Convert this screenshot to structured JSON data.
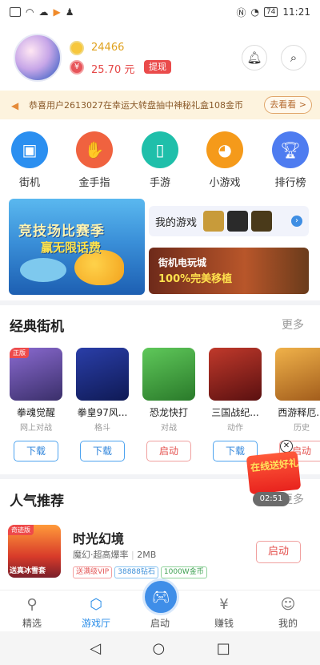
{
  "status_bar": {
    "time": "11:21",
    "battery": "74"
  },
  "profile": {
    "coins": "24466",
    "money": "25.70 元",
    "money_icon": "¥",
    "withdraw_label": "提现"
  },
  "notice": {
    "text": "恭喜用户2613027在幸运大转盘抽中神秘礼盒108金币",
    "button": "去看看 >"
  },
  "categories": [
    {
      "label": "街机",
      "color": "#2b8ff0"
    },
    {
      "label": "金手指",
      "color": "#f0623f"
    },
    {
      "label": "手游",
      "color": "#1fbfaa"
    },
    {
      "label": "小游戏",
      "color": "#f59a1a"
    },
    {
      "label": "排行榜",
      "color": "#4e7cf0"
    }
  ],
  "banners": {
    "left_line1": "竞技场比赛季",
    "left_line2": "赢无限话费",
    "my_games_label": "我的游戏",
    "right_line1": "街机电玩城",
    "right_line2": "100%完美移植"
  },
  "classic_section": {
    "title": "经典街机",
    "more": "更多"
  },
  "classic_games": [
    {
      "name": "拳魂觉醒",
      "category": "网上对战",
      "action": "下载",
      "tag": "正版",
      "color": "#5a4a8f"
    },
    {
      "name": "拳皇97风...",
      "category": "格斗",
      "action": "下载",
      "tag": "",
      "color": "#1d2d7a"
    },
    {
      "name": "恐龙快打",
      "category": "对战",
      "action": "启动",
      "tag": "",
      "color": "#3aa64a"
    },
    {
      "name": "三国战纪...",
      "category": "动作",
      "action": "下载",
      "tag": "",
      "color": "#8a1f1f"
    },
    {
      "name": "西游释厄...",
      "category": "历史",
      "action": "启动",
      "tag": "",
      "color": "#d48a2a"
    }
  ],
  "gift": {
    "text": "在线送好礼",
    "timer": "02:51"
  },
  "popular_section": {
    "title": "人气推荐",
    "more": "更多"
  },
  "popular_item": {
    "name": "时光幻境",
    "genre": "魔幻·超高爆率",
    "size": "2MB",
    "tag": "奇迹版",
    "thumb_text": "送真冰雪套",
    "pills": [
      "送满级VIP",
      "38888钻石",
      "1000W金币"
    ],
    "action": "启动"
  },
  "tabs": [
    {
      "label": "精选",
      "active": false
    },
    {
      "label": "游戏厅",
      "active": true
    },
    {
      "label": "启动",
      "active": false
    },
    {
      "label": "赚钱",
      "active": false
    },
    {
      "label": "我的",
      "active": false
    }
  ]
}
